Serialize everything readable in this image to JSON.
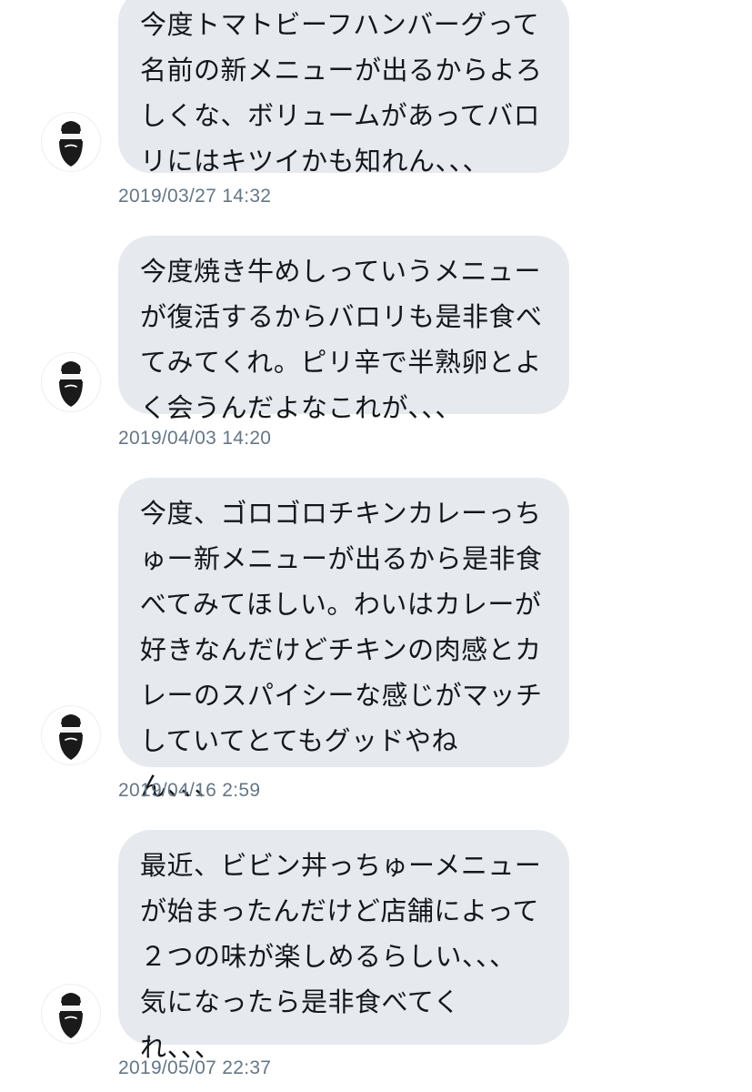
{
  "messages": [
    {
      "lines": [
        "今度トマトビーフハンバーグって",
        "名前の新メニューが出るからよろ",
        "しくな、ボリュームがあってバロ",
        "リにはキツイかも知れん、、、"
      ],
      "timestamp": "2019/03/27 14:32",
      "avatar_icon": "bearded-man-icon"
    },
    {
      "lines": [
        "今度焼き牛めしっていうメニュー",
        "が復活するからバロリも是非食べ",
        "てみてくれ。ピリ辛で半熟卵とよ",
        "く会うんだよなこれが、、、"
      ],
      "timestamp": "2019/04/03 14:20",
      "avatar_icon": "bearded-man-icon"
    },
    {
      "lines": [
        "今度、ゴロゴロチキンカレーっち",
        "ゅー新メニューが出るから是非食",
        "べてみてほしい。わいはカレーが",
        "好きなんだけどチキンの肉感とカ",
        "レーのスパイシーな感じがマッチ",
        "していてとてもグッドやね",
        "ん、、、"
      ],
      "timestamp": "2019/04/16 2:59",
      "avatar_icon": "bearded-man-icon"
    },
    {
      "lines": [
        "最近、ビビン丼っちゅーメニュー",
        "が始まったんだけど店舗によって",
        "２つの味が楽しめるらしい、、、",
        "気になったら是非食べてく",
        "れ、、、"
      ],
      "timestamp": "2019/05/07 22:37",
      "avatar_icon": "bearded-man-icon"
    }
  ],
  "colors": {
    "bubble_background": "#e6e9ee",
    "message_text": "#14171a",
    "timestamp_text": "#657786",
    "page_background": "#ffffff"
  }
}
